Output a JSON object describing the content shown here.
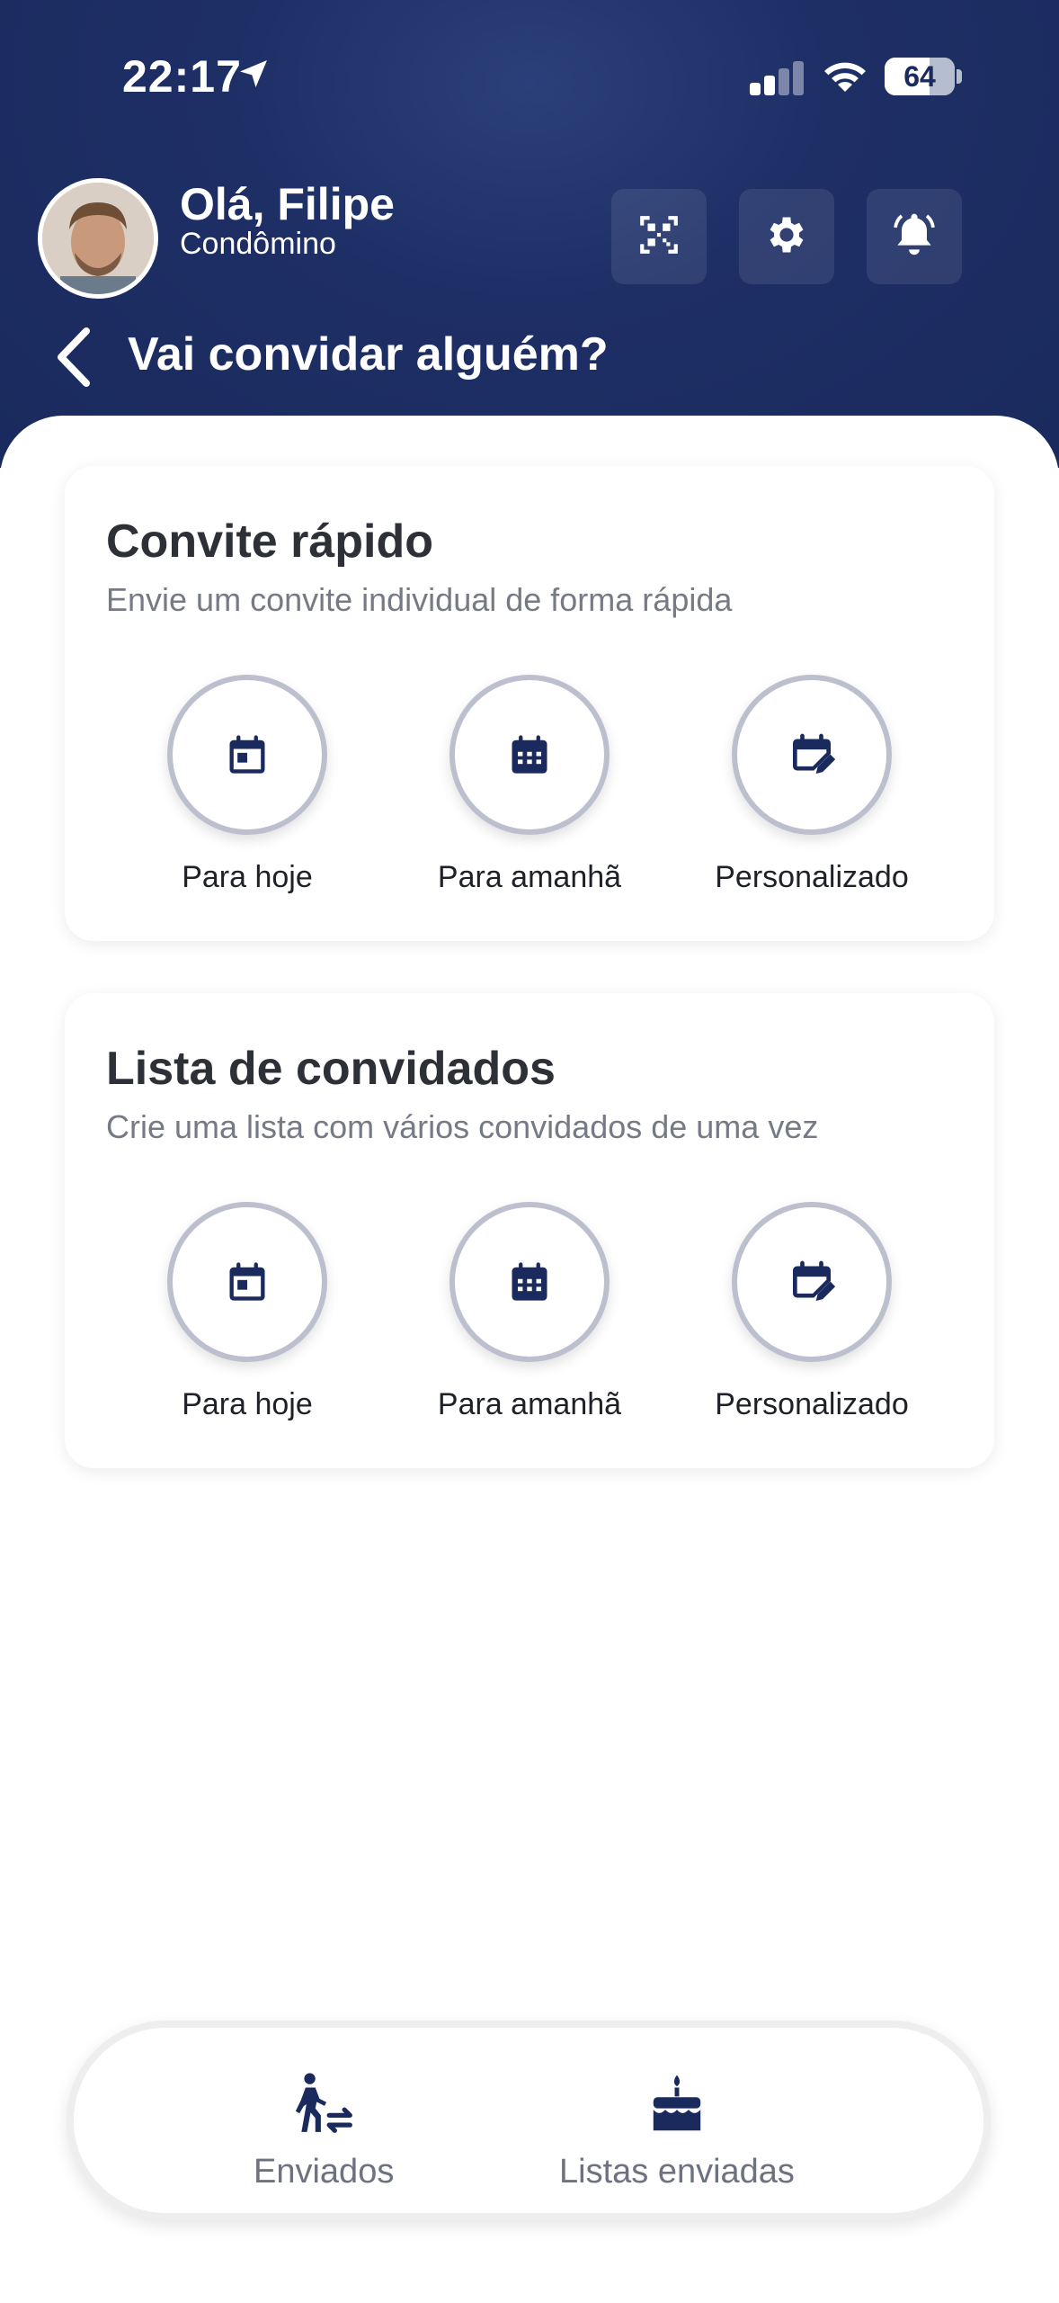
{
  "status_bar": {
    "time": "22:17",
    "battery": "64"
  },
  "header": {
    "greeting": "Olá, Filipe",
    "role": "Condômino",
    "page_title": "Vai convidar alguém?",
    "actions": [
      "qr-code-icon",
      "gear-icon",
      "bell-icon"
    ]
  },
  "cards": [
    {
      "title": "Convite rápido",
      "subtitle": "Envie um convite individual de forma rápida",
      "options": [
        {
          "label": "Para hoje",
          "icon": "calendar-today-icon"
        },
        {
          "label": "Para amanhã",
          "icon": "calendar-grid-icon"
        },
        {
          "label": "Personalizado",
          "icon": "calendar-edit-icon"
        }
      ]
    },
    {
      "title": "Lista de convidados",
      "subtitle": "Crie uma lista com vários convidados de uma vez",
      "options": [
        {
          "label": "Para hoje",
          "icon": "calendar-today-icon"
        },
        {
          "label": "Para amanhã",
          "icon": "calendar-grid-icon"
        },
        {
          "label": "Personalizado",
          "icon": "calendar-edit-icon"
        }
      ]
    }
  ],
  "bottom_nav": [
    {
      "label": "Enviados",
      "icon": "walking-person-transfer-icon"
    },
    {
      "label": "Listas enviadas",
      "icon": "cake-icon"
    }
  ],
  "colors": {
    "primary": "#1b2a5c",
    "header_bg": "#1e2f66",
    "ring": "#bcc0ce"
  }
}
